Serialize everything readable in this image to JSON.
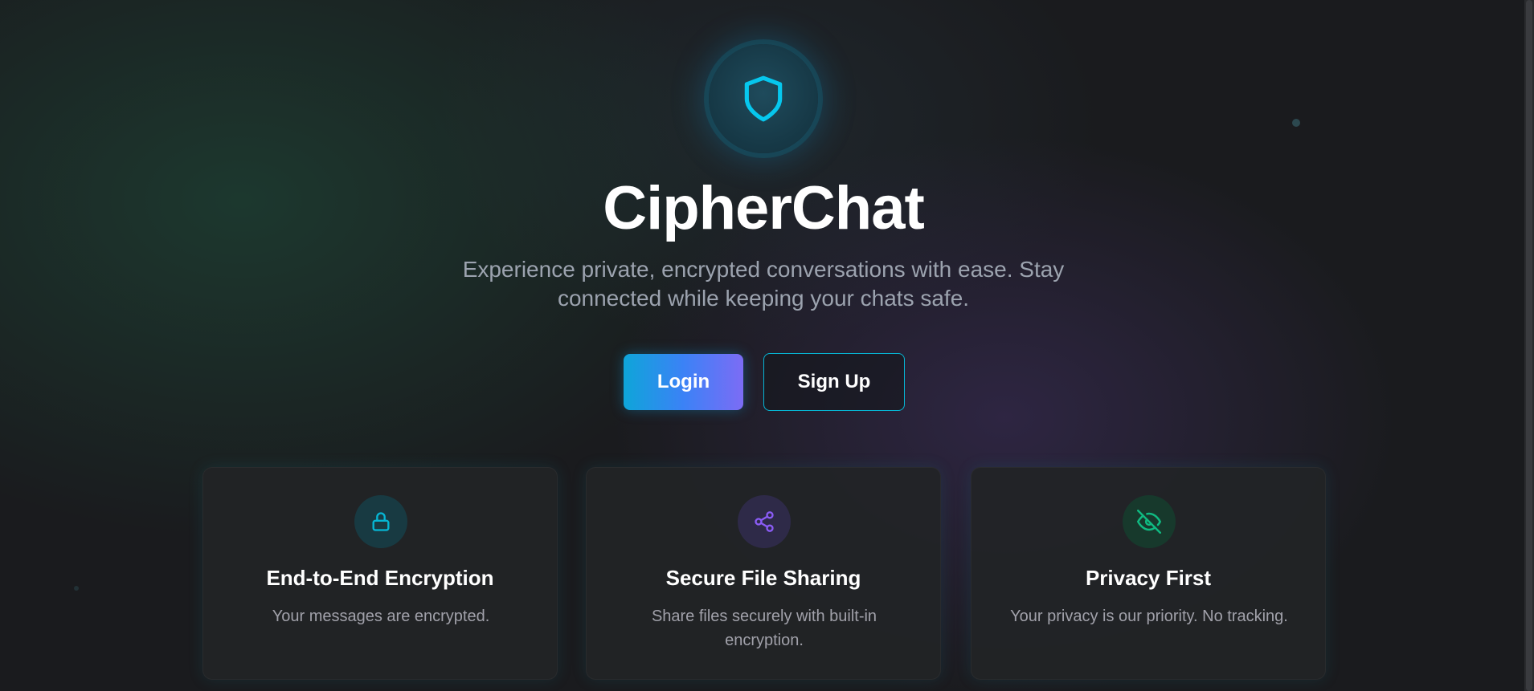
{
  "app": {
    "title": "CipherChat",
    "tagline": "Experience private, encrypted conversations with ease. Stay connected while keeping your chats safe.",
    "logo_icon": "shield-icon"
  },
  "actions": {
    "login_label": "Login",
    "signup_label": "Sign Up"
  },
  "features": [
    {
      "icon": "lock-icon",
      "title": "End-to-End Encryption",
      "description": "Your messages are encrypted.",
      "accent": "#06b6d4"
    },
    {
      "icon": "share-icon",
      "title": "Secure File Sharing",
      "description": "Share files securely with built-in encryption.",
      "accent": "#8b5cf6"
    },
    {
      "icon": "eye-off-icon",
      "title": "Privacy First",
      "description": "Your privacy is our priority. No tracking.",
      "accent": "#10b981"
    }
  ],
  "colors": {
    "background": "#1a1b1e",
    "primary_cyan": "#06b6d4",
    "primary_purple": "#7c6cf5",
    "text_muted": "#9ca3af"
  }
}
